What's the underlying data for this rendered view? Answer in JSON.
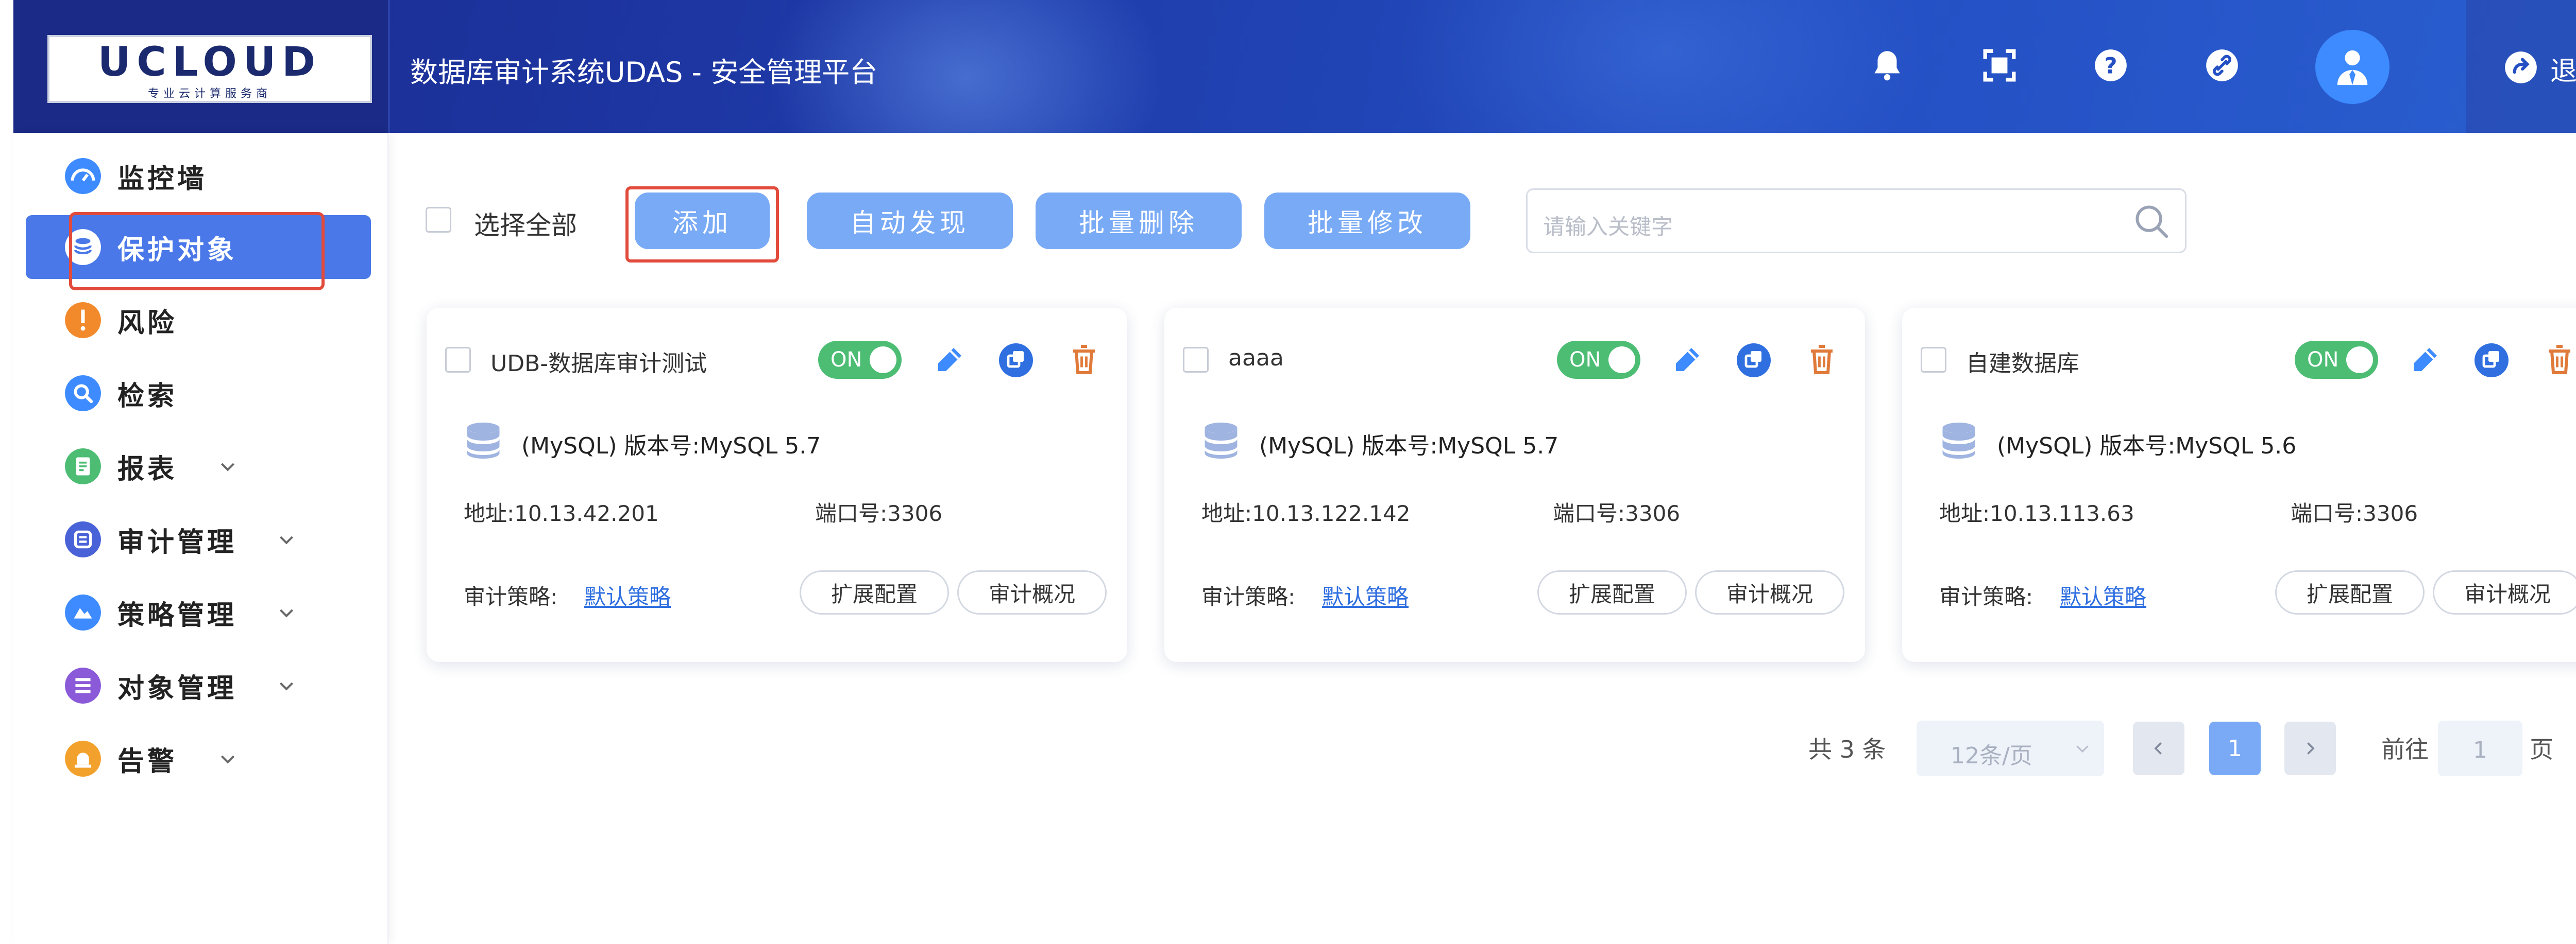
{
  "header": {
    "logo_text": "UCLOUD",
    "logo_subtext": "专业云计算服务商",
    "title": "数据库审计系统UDAS - 安全管理平台",
    "icons": [
      "bell-icon",
      "fullscreen-icon",
      "help-icon",
      "link-icon",
      "user-avatar-icon"
    ],
    "logout_label": "退出"
  },
  "sidebar": {
    "items": [
      {
        "label": "监控墙",
        "icon": "dashboard-icon",
        "color": "#3d8bff",
        "has_submenu": false
      },
      {
        "label": "保护对象",
        "icon": "database-icon",
        "color": "#ffffff",
        "has_submenu": false,
        "active": true
      },
      {
        "label": "风险",
        "icon": "warning-icon",
        "color": "#f28a2c",
        "has_submenu": false
      },
      {
        "label": "检索",
        "icon": "search-icon",
        "color": "#3d8bff",
        "has_submenu": false
      },
      {
        "label": "报表",
        "icon": "report-icon",
        "color": "#4dbd74",
        "has_submenu": true
      },
      {
        "label": "审计管理",
        "icon": "audit-icon",
        "color": "#4a62d8",
        "has_submenu": true
      },
      {
        "label": "策略管理",
        "icon": "policy-icon",
        "color": "#3d8bff",
        "has_submenu": true
      },
      {
        "label": "对象管理",
        "icon": "object-icon",
        "color": "#8a5ad8",
        "has_submenu": true
      },
      {
        "label": "告警",
        "icon": "alarm-icon",
        "color": "#f2a22c",
        "has_submenu": true
      }
    ]
  },
  "toolbar": {
    "select_all_label": "选择全部",
    "add_label": "添加",
    "auto_discover_label": "自动发现",
    "batch_delete_label": "批量删除",
    "batch_edit_label": "批量修改",
    "search_placeholder": "请输入关键字"
  },
  "cards": [
    {
      "title": "UDB-数据库审计测试",
      "toggle": "ON",
      "db_info": "(MySQL)   版本号:MySQL 5.7",
      "address": "地址:10.13.42.201",
      "port": "端口号:3306",
      "policy_label": "审计策略:",
      "policy_link": "默认策略",
      "ext_config": "扩展配置",
      "overview": "审计概况"
    },
    {
      "title": "aaaa",
      "toggle": "ON",
      "db_info": "(MySQL)   版本号:MySQL 5.7",
      "address": "地址:10.13.122.142",
      "port": "端口号:3306",
      "policy_label": "审计策略:",
      "policy_link": "默认策略",
      "ext_config": "扩展配置",
      "overview": "审计概况"
    },
    {
      "title": "自建数据库",
      "toggle": "ON",
      "db_info": "(MySQL)   版本号:MySQL 5.6",
      "address": "地址:10.13.113.63",
      "port": "端口号:3306",
      "policy_label": "审计策略:",
      "policy_link": "默认策略",
      "ext_config": "扩展配置",
      "overview": "审计概况"
    }
  ],
  "pagination": {
    "total": "共 3 条",
    "page_size": "12条/页",
    "current_page": "1",
    "goto_label": "前往",
    "goto_value": "1",
    "page_suffix": "页"
  },
  "colors": {
    "accent": "#79aaf5",
    "active_sidebar": "#4a78e8",
    "toggle_on": "#4dbd74",
    "highlight": "#e24b3b",
    "delete": "#e07a3a",
    "edit": "#3d8bff"
  }
}
